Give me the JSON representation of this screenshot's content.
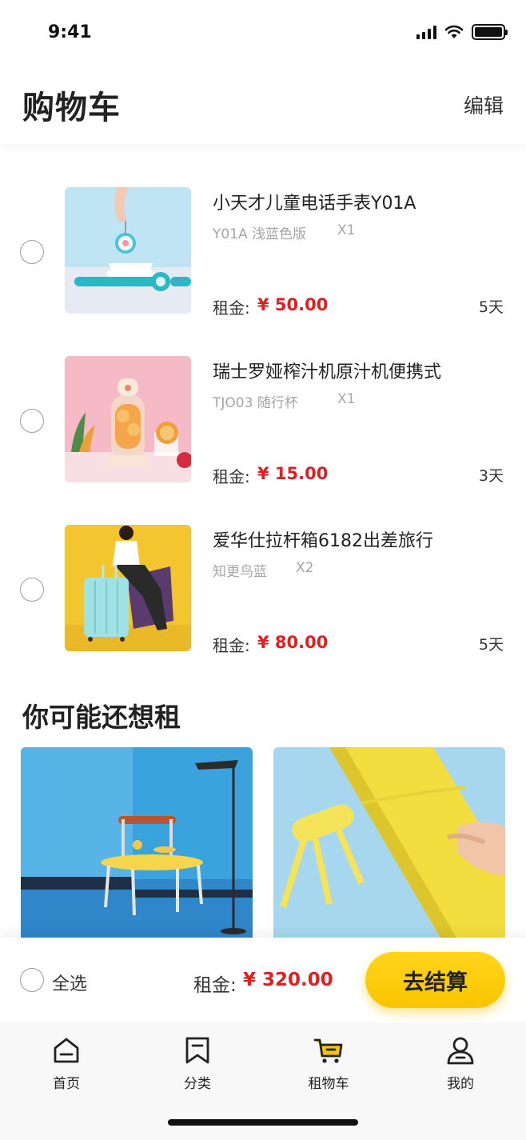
{
  "status_bar": {
    "time": "9:41"
  },
  "header": {
    "title": "购物车",
    "edit_label": "编辑"
  },
  "cart": {
    "items": [
      {
        "name": "小天才儿童电话手表Y01A",
        "spec": "Y01A 浅蓝色版",
        "qty": "X1",
        "price_label": "租金:",
        "price": "¥ 50.00",
        "days": "5天"
      },
      {
        "name": "瑞士罗娅榨汁机原汁机便携式",
        "spec": "TJO03 随行杯",
        "qty": "X1",
        "price_label": "租金:",
        "price": "¥ 15.00",
        "days": "3天"
      },
      {
        "name": "爱华仕拉杆箱6182出差旅行",
        "spec": "知更鸟蓝",
        "qty": "X2",
        "price_label": "租金:",
        "price": "¥ 80.00",
        "days": "5天"
      }
    ]
  },
  "recommend": {
    "title": "你可能还想租"
  },
  "checkout": {
    "select_all": "全选",
    "total_label": "租金:",
    "total_price": "¥ 320.00",
    "button_label": "去结算"
  },
  "tabs": [
    {
      "label": "首页",
      "icon": "home-icon"
    },
    {
      "label": "分类",
      "icon": "bookmark-icon"
    },
    {
      "label": "租物车",
      "icon": "cart-icon"
    },
    {
      "label": "我的",
      "icon": "user-icon"
    }
  ],
  "colors": {
    "accent": "#f9c400",
    "price": "#e02020"
  }
}
